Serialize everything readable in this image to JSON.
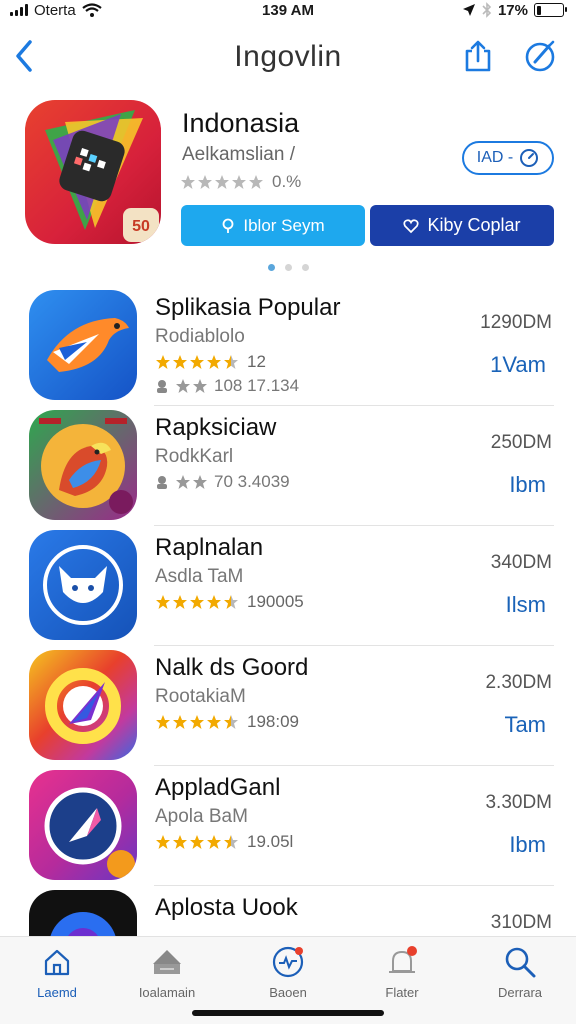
{
  "status_bar": {
    "carrier": "Oterta",
    "time": "139 AM",
    "battery": "17%",
    "battery_level": 0.17
  },
  "nav": {
    "title": "Ingovlin"
  },
  "featured": {
    "title": "Indonasia",
    "subtitle": "Aelkamslian /",
    "rating_text": "0.%",
    "badge_label": "IAD -",
    "button_primary": "Iblor Seym",
    "button_secondary": "Kiby Coplar",
    "badge_number": "50",
    "page_count": 3,
    "active_page": 0
  },
  "apps": [
    {
      "name": "Splikasia Popular",
      "developer": "Rodiablolo",
      "rating_count": "12",
      "meta": "108 17.134",
      "size": "1290DM",
      "action": "1Vam",
      "stars_filled": 4.5
    },
    {
      "name": "Rapksiciaw",
      "developer": "RodkKarl",
      "rating_count": "",
      "meta": "70 3.4039",
      "size": "250DM",
      "action": "Ibm",
      "stars_filled": 2
    },
    {
      "name": "Raplnalan",
      "developer": "Asdla TaM",
      "rating_count": "",
      "meta": "190005",
      "size": "340DM",
      "action": "Ilsm",
      "stars_filled": 4.5
    },
    {
      "name": "Nalk ds Goord",
      "developer": "RootakiaM",
      "rating_count": "",
      "meta": "198:09",
      "size": "2.30DM",
      "action": "Tam",
      "stars_filled": 4.5
    },
    {
      "name": "AppladGanl",
      "developer": "Apola BaM",
      "rating_count": "",
      "meta": "19.05l",
      "size": "3.30DM",
      "action": "Ibm",
      "stars_filled": 4.5
    },
    {
      "name": "Aplosta Uook",
      "developer": "",
      "rating_count": "",
      "meta": "",
      "size": "310DM",
      "action": "",
      "stars_filled": 0
    }
  ],
  "tabs": [
    {
      "label": "Laemd",
      "icon": "home-icon"
    },
    {
      "label": "Ioalamain",
      "icon": "apps-icon"
    },
    {
      "label": "Baoen",
      "icon": "compass-icon"
    },
    {
      "label": "Flater",
      "icon": "notification-icon"
    },
    {
      "label": "Derrara",
      "icon": "search-icon"
    }
  ],
  "colors": {
    "accent": "#1c5fb8",
    "star": "#f2a900",
    "star_empty": "#b8b8b8",
    "button_primary": "#1ea8ee",
    "button_secondary": "#1b3fa8"
  }
}
